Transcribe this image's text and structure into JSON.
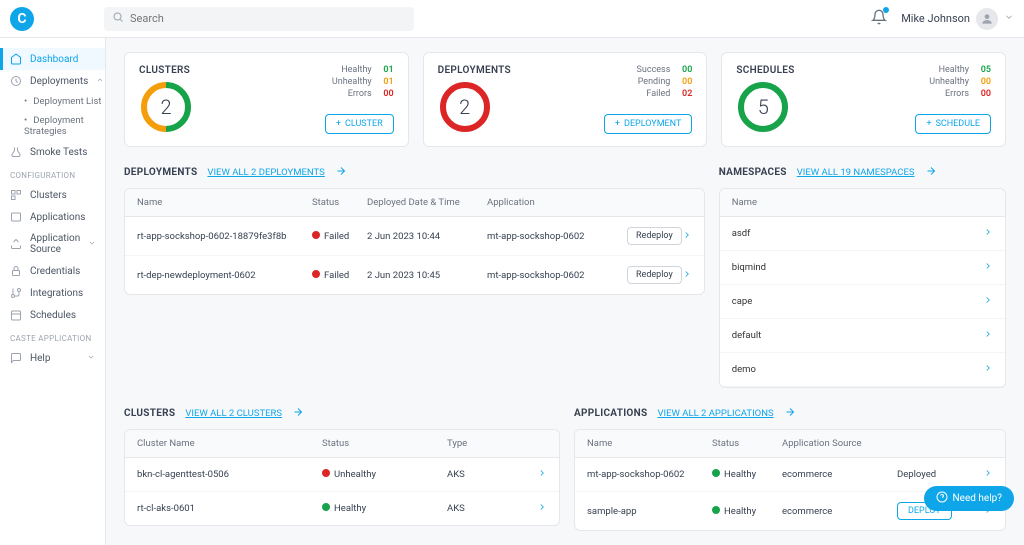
{
  "header": {
    "search_placeholder": "Search",
    "user_name": "Mike Johnson"
  },
  "sidebar": {
    "dashboard": "Dashboard",
    "deployments": "Deployments",
    "deployment_list": "Deployment List",
    "deployment_strategies": "Deployment Strategies",
    "smoke_tests": "Smoke Tests",
    "section_config": "CONFIGURATION",
    "clusters": "Clusters",
    "applications": "Applications",
    "application_source": "Application Source",
    "credentials": "Credentials",
    "integrations": "Integrations",
    "schedules": "Schedules",
    "section_cafe": "CASTE APPLICATION",
    "help": "Help"
  },
  "cards": {
    "clusters": {
      "title": "CLUSTERS",
      "count": "2",
      "healthy_label": "Healthy",
      "healthy_val": "01",
      "unhealthy_label": "Unhealthy",
      "unhealthy_val": "01",
      "errors_label": "Errors",
      "errors_val": "00",
      "btn": "CLUSTER"
    },
    "deployments": {
      "title": "DEPLOYMENTS",
      "count": "2",
      "success_label": "Success",
      "success_val": "00",
      "pending_label": "Pending",
      "pending_val": "00",
      "failed_label": "Failed",
      "failed_val": "02",
      "btn": "DEPLOYMENT"
    },
    "schedules": {
      "title": "SCHEDULES",
      "count": "5",
      "healthy_label": "Healthy",
      "healthy_val": "05",
      "unhealthy_label": "Unhealthy",
      "unhealthy_val": "00",
      "errors_label": "Errors",
      "errors_val": "00",
      "btn": "SCHEDULE"
    }
  },
  "deployments": {
    "title": "DEPLOYMENTS",
    "view_all": "VIEW ALL 2 DEPLOYMENTS",
    "cols": {
      "name": "Name",
      "status": "Status",
      "date": "Deployed Date & Time",
      "app": "Application"
    },
    "rows": [
      {
        "name": "rt-app-sockshop-0602-18879fe3f8b",
        "status": "Failed",
        "date": "2 Jun 2023 10:44",
        "app": "mt-app-sockshop-0602",
        "action": "Redeploy"
      },
      {
        "name": "rt-dep-newdeployment-0602",
        "status": "Failed",
        "date": "2 Jun 2023 10:45",
        "app": "mt-app-sockshop-0602",
        "action": "Redeploy"
      }
    ]
  },
  "namespaces": {
    "title": "NAMESPACES",
    "view_all": "VIEW ALL 19 NAMESPACES",
    "col_name": "Name",
    "rows": [
      "asdf",
      "biqmind",
      "cape",
      "default",
      "demo"
    ]
  },
  "clusters": {
    "title": "CLUSTERS",
    "view_all": "VIEW ALL 2 CLUSTERS",
    "cols": {
      "name": "Cluster Name",
      "status": "Status",
      "type": "Type"
    },
    "rows": [
      {
        "name": "bkn-cl-agenttest-0506",
        "status": "Unhealthy",
        "status_class": "red",
        "type": "AKS"
      },
      {
        "name": "rt-cl-aks-0601",
        "status": "Healthy",
        "status_class": "green",
        "type": "AKS"
      }
    ]
  },
  "applications": {
    "title": "APPLICATIONS",
    "view_all": "VIEW ALL 2 APPLICATIONS",
    "cols": {
      "name": "Name",
      "status": "Status",
      "src": "Application Source"
    },
    "rows": [
      {
        "name": "mt-app-sockshop-0602",
        "status": "Healthy",
        "src": "ecommerce",
        "deployed": "Deployed"
      },
      {
        "name": "sample-app",
        "status": "Healthy",
        "src": "ecommerce",
        "deploy_btn": "DEPLOY"
      }
    ]
  },
  "need_help": "Need help?"
}
